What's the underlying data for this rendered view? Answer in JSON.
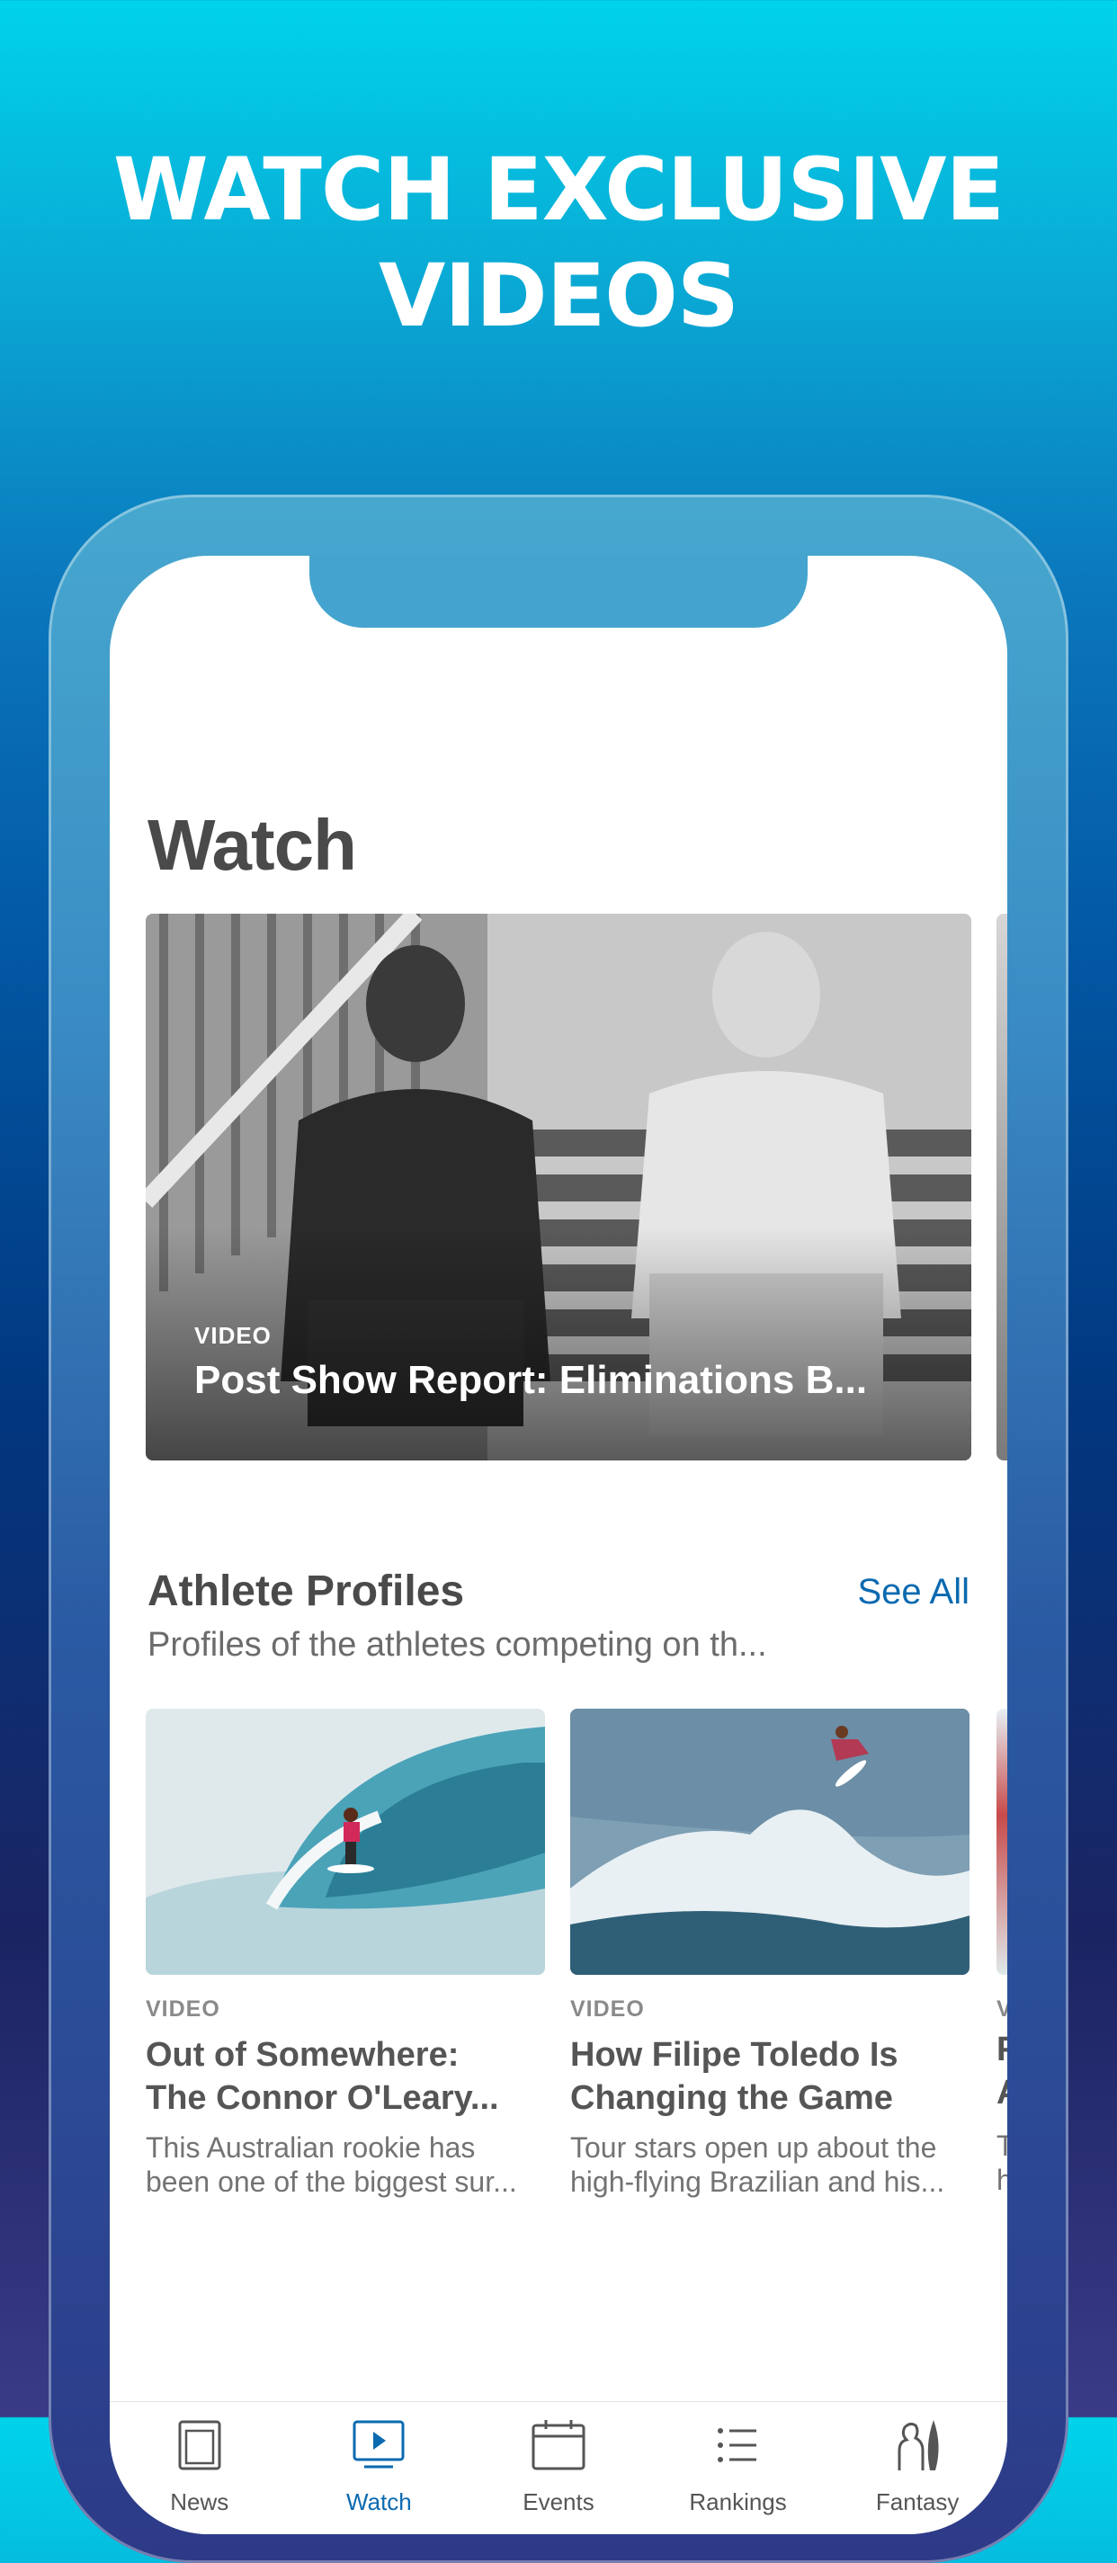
{
  "promo": {
    "line1": "WATCH EXCLUSIVE",
    "line2": "VIDEOS"
  },
  "page": {
    "title": "Watch"
  },
  "hero": {
    "eyebrow": "VIDEO",
    "title": "Post Show Report: Eliminations B..."
  },
  "athlete_profiles": {
    "title": "Athlete Profiles",
    "see_all": "See All",
    "subtitle": "Profiles of the athletes competing on th...",
    "cards": [
      {
        "eyebrow": "VIDEO",
        "title_line1": "Out of Somewhere:",
        "title_line2": "The Connor O'Leary...",
        "desc_line1": "This Australian rookie has",
        "desc_line2": "been one of the biggest sur..."
      },
      {
        "eyebrow": "VIDEO",
        "title_line1": "How Filipe Toledo Is",
        "title_line2": "Changing the Game",
        "desc_line1": "Tour stars open up about the",
        "desc_line2": "high-flying Brazilian and his..."
      }
    ],
    "peek_eyebrow": "V",
    "peek_line1": "F",
    "peek_line2": "A",
    "peek_desc1": "T",
    "peek_desc2": "h"
  },
  "tabbar": {
    "active": "Watch",
    "accent_color": "#0b6ab0",
    "items": [
      {
        "label": "News",
        "icon": "news-icon"
      },
      {
        "label": "Watch",
        "icon": "watch-play-icon"
      },
      {
        "label": "Events",
        "icon": "calendar-icon"
      },
      {
        "label": "Rankings",
        "icon": "list-icon"
      },
      {
        "label": "Fantasy",
        "icon": "surfer-board-icon"
      }
    ]
  }
}
